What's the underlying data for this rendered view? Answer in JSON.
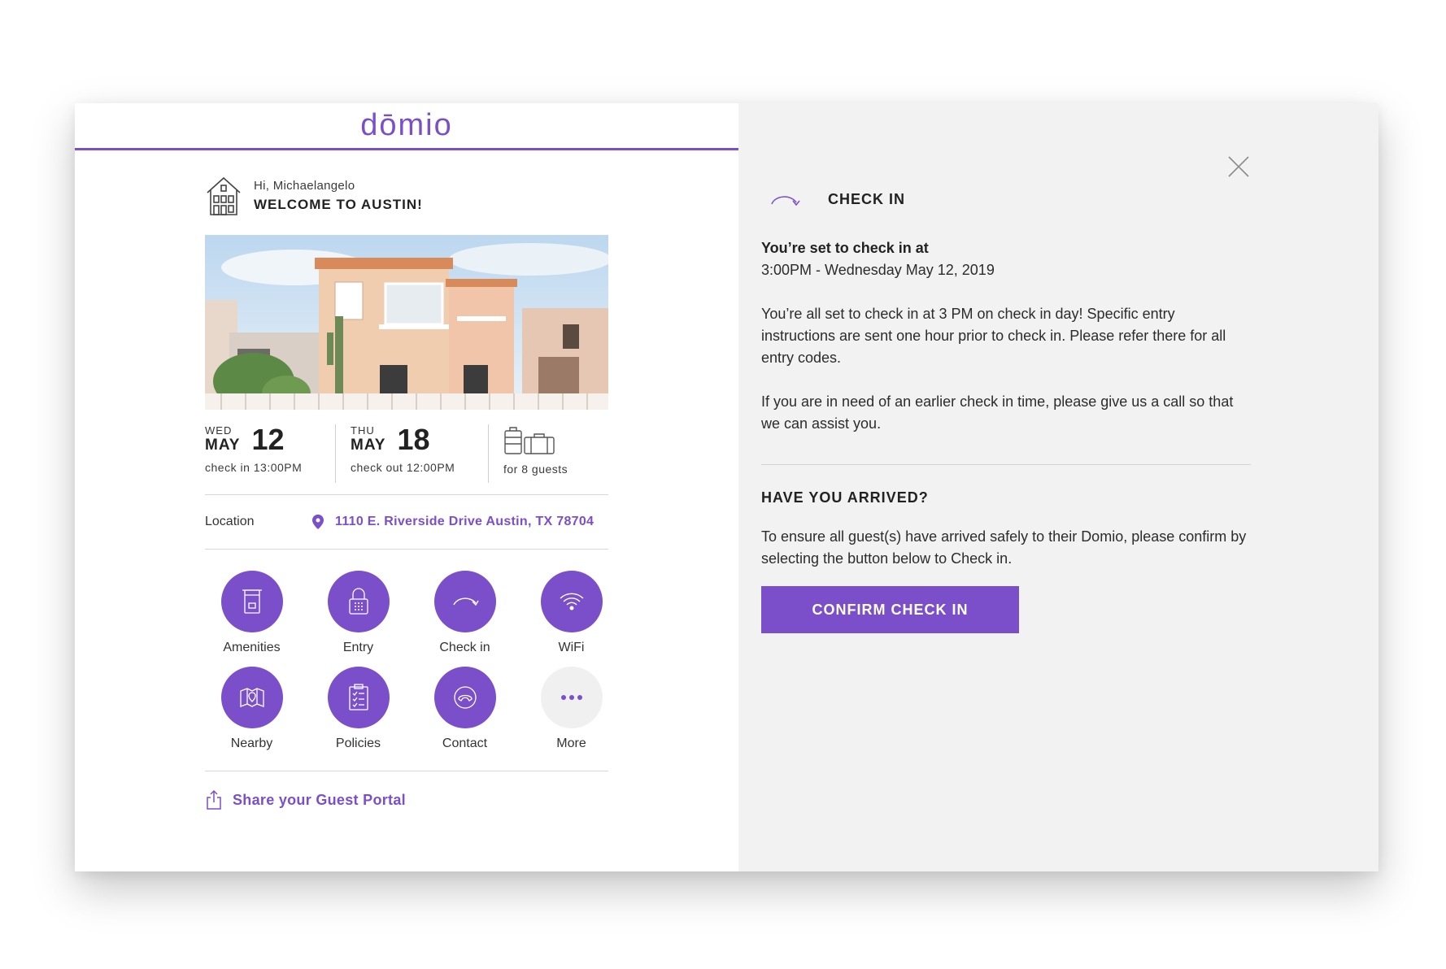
{
  "brand": {
    "logo": "dōmio",
    "accent": "#7a4fc9"
  },
  "welcome": {
    "greeting": "Hi, Michaelangelo",
    "title": "WELCOME TO AUSTIN!"
  },
  "stay": {
    "checkin": {
      "dow": "WED",
      "month": "MAY",
      "day": "12",
      "sub": "check in 13:00PM"
    },
    "checkout": {
      "dow": "THU",
      "month": "MAY",
      "day": "18",
      "sub": "check out 12:00PM"
    },
    "guests": {
      "sub": "for 8 guests",
      "icon": "luggage-icon"
    }
  },
  "location": {
    "label": "Location",
    "address": "1110 E. Riverside Drive Austin, TX 78704",
    "icon": "map-pin-icon"
  },
  "tiles": [
    {
      "label": "Amenities",
      "icon": "amenities-icon"
    },
    {
      "label": "Entry",
      "icon": "lock-icon"
    },
    {
      "label": "Check in",
      "icon": "check-in-arrow-icon"
    },
    {
      "label": "WiFi",
      "icon": "wifi-icon"
    },
    {
      "label": "Nearby",
      "icon": "map-icon"
    },
    {
      "label": "Policies",
      "icon": "clipboard-icon"
    },
    {
      "label": "Contact",
      "icon": "phone-icon"
    },
    {
      "label": "More",
      "icon": "more-dots-icon"
    }
  ],
  "share": {
    "label": "Share your Guest Portal",
    "icon": "share-icon"
  },
  "panel": {
    "title": "CHECK IN",
    "set_title": "You’re set to check in at",
    "set_time": "3:00PM - Wednesday May 12, 2019",
    "para1": "You’re all set to check in at 3 PM on check in day! Specific entry instructions are sent one hour prior to check in. Please refer there for all entry codes.",
    "para2": "If you are in need of an earlier check in time, please give us a call so that we can assist you.",
    "arrived_title": "HAVE YOU ARRIVED?",
    "para3": "To ensure all guest(s) have arrived safely to their Domio, please confirm by selecting the button below to Check in.",
    "confirm_label": "CONFIRM CHECK IN"
  }
}
